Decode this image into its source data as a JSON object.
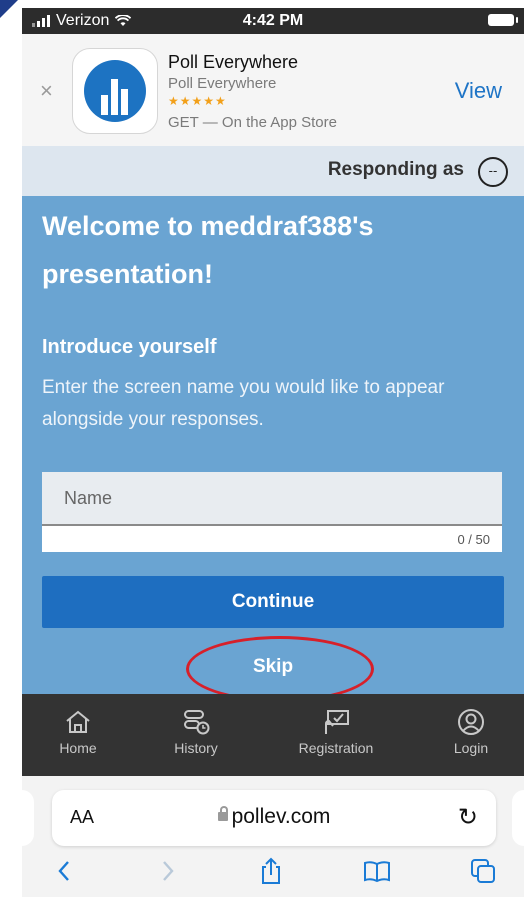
{
  "status_bar": {
    "carrier": "Verizon",
    "time": "4:42 PM"
  },
  "app_banner": {
    "close": "×",
    "app_name": "Poll Everywhere",
    "developer": "Poll Everywhere",
    "rating_stars": "★★★★★",
    "store_line": "GET — On the App Store",
    "view_label": "View"
  },
  "responding": {
    "label": "Responding as",
    "avatar_text": "--"
  },
  "main": {
    "title": "Welcome to meddraf388's presentation!",
    "subtitle": "Introduce yourself",
    "description": "Enter the screen name you would like to appear alongside your responses.",
    "name_placeholder": "Name",
    "char_count": "0 / 50",
    "continue_label": "Continue",
    "skip_label": "Skip"
  },
  "nav": {
    "items": [
      {
        "label": "Home",
        "icon": "home-icon"
      },
      {
        "label": "History",
        "icon": "history-icon"
      },
      {
        "label": "Registration",
        "icon": "registration-icon"
      },
      {
        "label": "Login",
        "icon": "login-icon"
      }
    ]
  },
  "browser": {
    "aa_label": "AA",
    "url": "pollev.com",
    "reload": "↻",
    "toolbar": [
      "back-icon",
      "forward-icon",
      "share-icon",
      "bookmarks-icon",
      "tabs-icon"
    ]
  },
  "colors": {
    "accent": "#1e6ec0",
    "main_bg": "#6aa4d2",
    "highlight_circle": "#d7202a"
  }
}
